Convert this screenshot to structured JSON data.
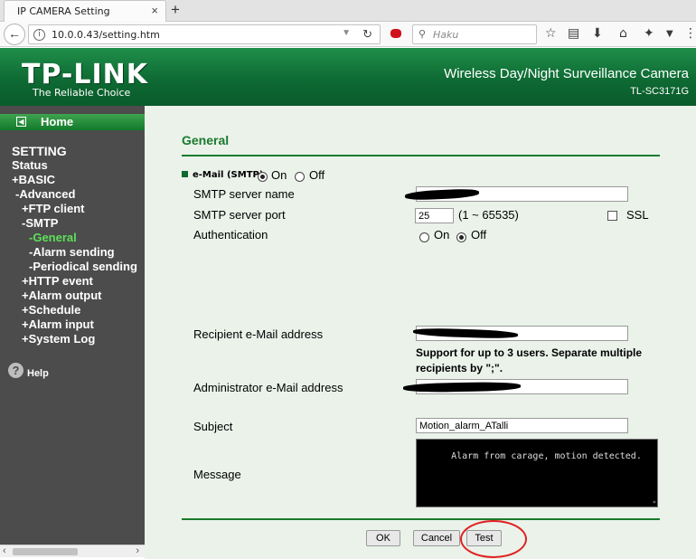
{
  "browser": {
    "tab_title": "IP CAMERA Setting",
    "tab_close": "×",
    "new_tab": "+",
    "url": "10.0.0.43/setting.htm",
    "search_placeholder": "Haku",
    "icons": [
      "back-arrow-icon",
      "info-icon",
      "reload-icon",
      "extension-icon",
      "search-icon",
      "bookmark-star-icon",
      "reading-list-icon",
      "download-icon",
      "home-icon",
      "extension-tool-icon",
      "menu-dropdown-icon",
      "overflow-icon"
    ]
  },
  "header": {
    "logo": "TP-LINK",
    "tagline": "The Reliable Choice",
    "product": "Wireless Day/Night Surveillance Camera",
    "model": "TL-SC3171G"
  },
  "sidebar": {
    "home": "Home",
    "items": [
      {
        "label": "SETTING"
      },
      {
        "label": "Status"
      },
      {
        "label": "+BASIC"
      },
      {
        "label": "-Advanced"
      },
      {
        "label": "+FTP client"
      },
      {
        "label": "-SMTP"
      },
      {
        "label": "-General",
        "active": true
      },
      {
        "label": "-Alarm sending"
      },
      {
        "label": "-Periodical sending"
      },
      {
        "label": "+HTTP event"
      },
      {
        "label": "+Alarm output"
      },
      {
        "label": "+Schedule"
      },
      {
        "label": "+Alarm input"
      },
      {
        "label": "+System Log"
      }
    ],
    "help": "Help"
  },
  "main": {
    "section_title": "General",
    "email": {
      "label": "e-Mail (SMTP)",
      "on_label": "On",
      "off_label": "Off",
      "selected": "On"
    },
    "smtp_server_name": {
      "label": "SMTP server name",
      "value": ""
    },
    "smtp_server_port": {
      "label": "SMTP server port",
      "value": "25",
      "range": "(1 ~ 65535)",
      "ssl_label": "SSL",
      "ssl_checked": false
    },
    "authentication": {
      "label": "Authentication",
      "on_label": "On",
      "off_label": "Off",
      "selected": "Off"
    },
    "recipient": {
      "label": "Recipient e-Mail address",
      "value": "",
      "note_line1": "Support for up to 3 users. Separate multiple",
      "note_line2": "recipients by \";\"."
    },
    "admin": {
      "label": "Administrator e-Mail address",
      "value": ""
    },
    "subject": {
      "label": "Subject",
      "value": "Motion_alarm_ATalli"
    },
    "message": {
      "label": "Message",
      "value": "Alarm from carage, motion detected."
    },
    "buttons": {
      "ok": "OK",
      "cancel": "Cancel",
      "test": "Test"
    },
    "annotation_color": "#e02020"
  }
}
